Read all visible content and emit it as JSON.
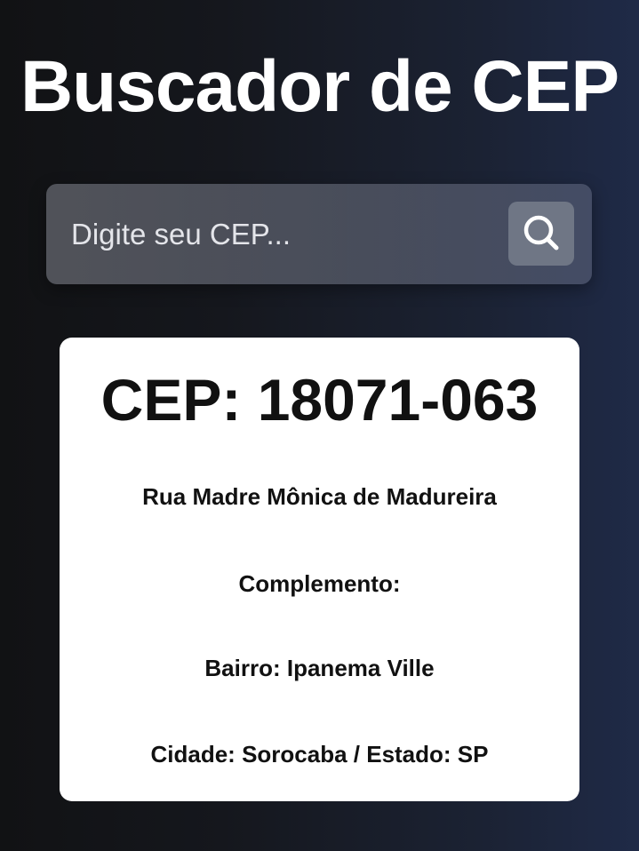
{
  "header": {
    "title": "Buscador de CEP"
  },
  "search": {
    "placeholder": "Digite seu CEP...",
    "value": "",
    "button_icon": "search-icon"
  },
  "result": {
    "cep_heading": "CEP: 18071-063",
    "street": "Rua Madre Mônica de Madureira",
    "complemento": "Complemento:",
    "bairro": "Bairro: Ipanema Ville",
    "cidade_estado": "Cidade: Sorocaba / Estado: SP"
  },
  "colors": {
    "background_left": "#111214",
    "background_right": "#1f2a47",
    "card": "#ffffff",
    "text_dark": "#111111",
    "title": "#ffffff",
    "search_button": "#6f7685"
  }
}
